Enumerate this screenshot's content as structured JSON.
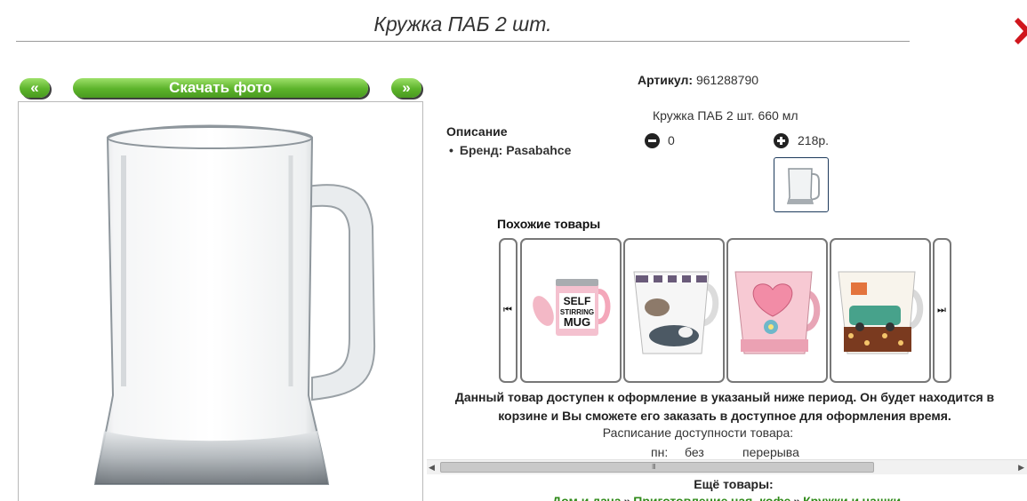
{
  "page": {
    "title": "Кружка ПАБ 2 шт."
  },
  "gallery": {
    "prev_label": "«",
    "download_label": "Скачать фото",
    "next_label": "»"
  },
  "product": {
    "sku_label": "Артикул:",
    "sku_value": "961288790",
    "description_heading": "Описание",
    "brand": "Бренд: Pasabahce",
    "variant_name": "Кружка ПАБ 2 шт. 660 мл",
    "quantity": "0",
    "price": "218р."
  },
  "similar": {
    "heading": "Похожие товары",
    "prev_arrow": "⏮",
    "next_arrow": "⏭",
    "items": [
      {
        "print_line1": "SELF",
        "print_line2": "STIRRING",
        "print_line3": "MUG"
      },
      {
        "print_line1": ""
      },
      {
        "print_line1": ""
      },
      {
        "print_line1": ""
      }
    ]
  },
  "availability": {
    "notice": "Данный товар доступен к оформление в указаный ниже период. Он будет находится в корзине и Вы сможете его заказать в доступное для оформления время.",
    "schedule_title": "Расписание доступности товара:",
    "schedule_day": "пн:",
    "schedule_from": "без",
    "schedule_to": "перерыва"
  },
  "scrollbar": {
    "left_arrow": "◀",
    "right_arrow": "▶",
    "grip": "III"
  },
  "more": {
    "heading": "Ещё товары:",
    "crumbs": [
      "Дом и дача",
      "Приготовление чая, кофе",
      "Кружки и чашки"
    ],
    "separator": "»"
  },
  "colors": {
    "button_green": "#5cb32b",
    "link_green": "#2f8a19",
    "close_red": "#d0161d"
  },
  "icons": {
    "close": "close-x-icon",
    "minus": "minus-circle-icon",
    "plus": "plus-circle-icon"
  }
}
